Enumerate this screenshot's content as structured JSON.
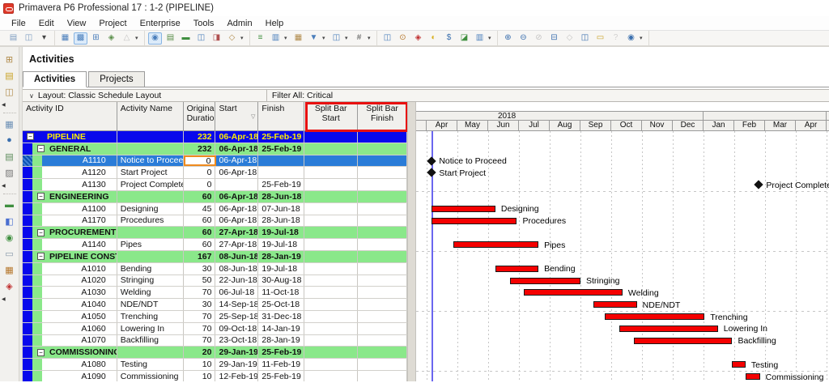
{
  "window": {
    "title": "Primavera P6 Professional 17 : 1-2 (PIPELINE)"
  },
  "menu": {
    "items": [
      "File",
      "Edit",
      "View",
      "Project",
      "Enterprise",
      "Tools",
      "Admin",
      "Help"
    ]
  },
  "toolbar": {
    "groups": [
      [
        {
          "name": "print-icon",
          "glyph": "▤",
          "color": "#7d9cc0"
        },
        {
          "name": "print-preview-icon",
          "glyph": "◫",
          "color": "#7d9cc0"
        },
        {
          "name": "group-overflow-arrow-icon",
          "glyph": "▾",
          "color": "#444",
          "dd": false
        }
      ],
      [
        {
          "name": "table-view-icon",
          "glyph": "▦",
          "color": "#4a7ebb"
        },
        {
          "name": "gantt-view-icon",
          "glyph": "▩",
          "color": "#4a7ebb",
          "active": true
        },
        {
          "name": "activity-network-icon",
          "glyph": "⊞",
          "color": "#4a7ebb"
        },
        {
          "name": "trace-logic-icon",
          "glyph": "◈",
          "color": "#5a8f4a"
        },
        {
          "name": "wbs-chart-icon",
          "glyph": "△",
          "color": "#777",
          "disabled": true,
          "dd": true
        }
      ],
      [
        {
          "name": "show-details-icon",
          "glyph": "◉",
          "color": "#4a7ebb",
          "active": true
        },
        {
          "name": "spreadsheet-icon",
          "glyph": "▤",
          "color": "#5a8f4a"
        },
        {
          "name": "resource-profile-icon",
          "glyph": "▬",
          "color": "#3f8f3f"
        },
        {
          "name": "resource-usage-icon",
          "glyph": "◫",
          "color": "#4a7ebb"
        },
        {
          "name": "tracking-view-icon",
          "glyph": "◨",
          "color": "#b05050"
        },
        {
          "name": "select-tool-icon",
          "glyph": "◇",
          "color": "#b08a4a",
          "dd": true
        }
      ],
      [
        {
          "name": "bars-layout-icon",
          "glyph": "≡",
          "color": "#3f8f3f"
        },
        {
          "name": "columns-icon",
          "glyph": "▥",
          "color": "#4a7ebb",
          "dd": true
        },
        {
          "name": "timescale-icon",
          "glyph": "▦",
          "color": "#b08a4a"
        },
        {
          "name": "filter-icon",
          "glyph": "▼",
          "color": "#4a7ebb",
          "dd": true
        },
        {
          "name": "group-sort-icon",
          "glyph": "◫",
          "color": "#4a7ebb",
          "dd": true
        },
        {
          "name": "line-numbers-icon",
          "glyph": "#",
          "color": "#555",
          "dd": true
        }
      ],
      [
        {
          "name": "activity-details-icon",
          "glyph": "◫",
          "color": "#4a7ebb"
        },
        {
          "name": "schedule-icon",
          "glyph": "⊙",
          "color": "#b5762a"
        },
        {
          "name": "level-resources-icon",
          "glyph": "◈",
          "color": "#c03030"
        },
        {
          "name": "progress-spotlight-icon",
          "glyph": "◐",
          "color": "#d8b020"
        },
        {
          "name": "store-period-performance-icon",
          "glyph": "$",
          "color": "#3a6fae"
        },
        {
          "name": "update-progress-icon",
          "glyph": "◪",
          "color": "#3f8f3f"
        },
        {
          "name": "customize-toolbar-icon",
          "glyph": "▥",
          "color": "#4a7ebb",
          "dd": true
        }
      ],
      [
        {
          "name": "zoom-in-icon",
          "glyph": "⊕",
          "color": "#3a6fae"
        },
        {
          "name": "zoom-out-icon",
          "glyph": "⊖",
          "color": "#3a6fae"
        },
        {
          "name": "zoom-100-icon",
          "glyph": "⊘",
          "color": "#777",
          "disabled": true
        },
        {
          "name": "horizontal-split-icon",
          "glyph": "⊟",
          "color": "#3a6fae"
        },
        {
          "name": "bookmark-icon",
          "glyph": "◇",
          "color": "#777",
          "disabled": true
        },
        {
          "name": "vertical-split-icon",
          "glyph": "◫",
          "color": "#3a6fae"
        },
        {
          "name": "notebook-icon",
          "glyph": "▭",
          "color": "#c9a227"
        },
        {
          "name": "help-icon",
          "glyph": "?",
          "color": "#999",
          "disabled": true
        },
        {
          "name": "online-help-icon",
          "glyph": "◉",
          "color": "#3a6fae",
          "dd": true
        }
      ]
    ]
  },
  "sidebar": {
    "items": [
      {
        "name": "add-project-icon",
        "glyph": "⊞",
        "color": "#b08a4a"
      },
      {
        "name": "open-project-icon",
        "glyph": "▤",
        "color": "#c9a227"
      },
      {
        "name": "import-icon",
        "glyph": "◫",
        "color": "#b08a4a"
      },
      {
        "name": "collapse-arrow-icon",
        "glyph": "◀",
        "arrow": true
      },
      {
        "sep": true
      },
      {
        "name": "projects-icon",
        "glyph": "▦",
        "color": "#6b8fb5"
      },
      {
        "name": "resources-icon",
        "glyph": "●",
        "color": "#3a6fae"
      },
      {
        "name": "reports-icon",
        "glyph": "▤",
        "color": "#5a8a5a"
      },
      {
        "name": "tracking-icon",
        "glyph": "▨",
        "color": "#777777"
      },
      {
        "name": "collapse-arrow-icon",
        "glyph": "◀",
        "arrow": true
      },
      {
        "sep": true
      },
      {
        "name": "assignments-icon",
        "glyph": "▬",
        "color": "#3f8f3f"
      },
      {
        "name": "roles-icon",
        "glyph": "◧",
        "color": "#4a6fd0"
      },
      {
        "name": "resource-assignments-icon",
        "glyph": "◉",
        "color": "#3f8f3f"
      },
      {
        "name": "wps-docs-icon",
        "glyph": "▭",
        "color": "#8899aa"
      },
      {
        "name": "expenses-icon",
        "glyph": "▦",
        "color": "#b5762a"
      },
      {
        "name": "risks-icon",
        "glyph": "◈",
        "color": "#c03030"
      },
      {
        "name": "collapse-arrow-icon",
        "glyph": "◀",
        "arrow": true
      }
    ]
  },
  "page": {
    "title": "Activities",
    "tabs": [
      {
        "label": "Activities",
        "active": true
      },
      {
        "label": "Projects",
        "active": false
      }
    ],
    "layout_label": "Layout: Classic Schedule Layout",
    "filter_label": "Filter All: Critical"
  },
  "table": {
    "columns": [
      {
        "label": "Activity ID"
      },
      {
        "label": "Activity Name"
      },
      {
        "label": "Original Duration"
      },
      {
        "label": "Start"
      },
      {
        "label": "Finish"
      },
      {
        "label": "Split Bar Start"
      },
      {
        "label": "Split Bar Finish"
      }
    ]
  },
  "chart_data": {
    "type": "gantt",
    "timeline": {
      "start_month": "Apr-2018",
      "months": [
        "Apr",
        "May",
        "Jun",
        "Jul",
        "Aug",
        "Sep",
        "Oct",
        "Nov",
        "Dec",
        "Jan",
        "Feb",
        "Mar",
        "Apr"
      ],
      "years": [
        {
          "label": "2018",
          "months_covered": 9
        },
        {
          "label": "",
          "months_covered": 4
        }
      ],
      "data_date": "06-Apr-18"
    },
    "colors": {
      "bar": "#f50000",
      "milestone": "#111111",
      "project_row": "#0808ec",
      "project_text": "#ffee00",
      "wbs_row": "#8ae88a",
      "selected_row": "#2a7cd8",
      "selected_cell_border": "#ef8b1f",
      "data_date_line": "#6a66ef",
      "annotation_box": "#e81010"
    },
    "activities": [
      {
        "kind": "project",
        "id": "PIPELINE",
        "name": "",
        "dur": "232",
        "start": "06-Apr-18",
        "finish": "25-Feb-19"
      },
      {
        "kind": "wbs",
        "id": "GENERAL",
        "name": "",
        "dur": "232",
        "start": "06-Apr-18",
        "finish": "25-Feb-19"
      },
      {
        "kind": "task",
        "id": "A1110",
        "name": "Notice to Proceed",
        "dur": "0",
        "start": "06-Apr-18",
        "finish": "",
        "selected": true,
        "milestone": "start"
      },
      {
        "kind": "task",
        "id": "A1120",
        "name": "Start Project",
        "dur": "0",
        "start": "06-Apr-18",
        "finish": "",
        "milestone": "start"
      },
      {
        "kind": "task",
        "id": "A1130",
        "name": "Project Complete",
        "dur": "0",
        "start": "",
        "finish": "25-Feb-19",
        "milestone": "finish"
      },
      {
        "kind": "wbs",
        "id": "ENGINEERING",
        "name": "",
        "dur": "60",
        "start": "06-Apr-18",
        "finish": "28-Jun-18"
      },
      {
        "kind": "task",
        "id": "A1100",
        "name": "Designing",
        "dur": "45",
        "start": "06-Apr-18",
        "finish": "07-Jun-18"
      },
      {
        "kind": "task",
        "id": "A1170",
        "name": "Procedures",
        "dur": "60",
        "start": "06-Apr-18",
        "finish": "28-Jun-18"
      },
      {
        "kind": "wbs",
        "id": "PROCUREMENT",
        "name": "",
        "dur": "60",
        "start": "27-Apr-18",
        "finish": "19-Jul-18"
      },
      {
        "kind": "task",
        "id": "A1140",
        "name": "Pipes",
        "dur": "60",
        "start": "27-Apr-18",
        "finish": "19-Jul-18"
      },
      {
        "kind": "wbs",
        "id": "PIPELINE CONSTRUCTION",
        "name": "",
        "dur": "167",
        "start": "08-Jun-18",
        "finish": "28-Jan-19"
      },
      {
        "kind": "task",
        "id": "A1010",
        "name": "Bending",
        "dur": "30",
        "start": "08-Jun-18",
        "finish": "19-Jul-18"
      },
      {
        "kind": "task",
        "id": "A1020",
        "name": "Stringing",
        "dur": "50",
        "start": "22-Jun-18",
        "finish": "30-Aug-18"
      },
      {
        "kind": "task",
        "id": "A1030",
        "name": "Welding",
        "dur": "70",
        "start": "06-Jul-18",
        "finish": "11-Oct-18"
      },
      {
        "kind": "task",
        "id": "A1040",
        "name": "NDE/NDT",
        "dur": "30",
        "start": "14-Sep-18",
        "finish": "25-Oct-18"
      },
      {
        "kind": "task",
        "id": "A1050",
        "name": "Trenching",
        "dur": "70",
        "start": "25-Sep-18",
        "finish": "31-Dec-18"
      },
      {
        "kind": "task",
        "id": "A1060",
        "name": "Lowering In",
        "dur": "70",
        "start": "09-Oct-18",
        "finish": "14-Jan-19"
      },
      {
        "kind": "task",
        "id": "A1070",
        "name": "Backfilling",
        "dur": "70",
        "start": "23-Oct-18",
        "finish": "28-Jan-19"
      },
      {
        "kind": "wbs",
        "id": "COMMISSIONING",
        "name": "",
        "dur": "20",
        "start": "29-Jan-19",
        "finish": "25-Feb-19"
      },
      {
        "kind": "task",
        "id": "A1080",
        "name": "Testing",
        "dur": "10",
        "start": "29-Jan-19",
        "finish": "11-Feb-19"
      },
      {
        "kind": "task",
        "id": "A1090",
        "name": "Commissioning",
        "dur": "10",
        "start": "12-Feb-19",
        "finish": "25-Feb-19"
      }
    ]
  }
}
